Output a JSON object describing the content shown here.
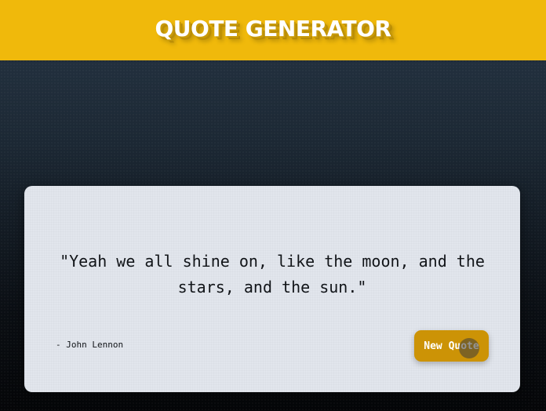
{
  "header": {
    "title": "QUOTE GENERATOR"
  },
  "quote": {
    "text": "\"Yeah we all shine on, like the moon, and the stars, and the sun.\"",
    "author": "- John Lennon"
  },
  "actions": {
    "new_quote_label": "New Quote"
  },
  "colors": {
    "header_bg": "#f0b90b",
    "button_bg": "#cc9306",
    "card_bg": "#e2e6ed",
    "page_bg_top": "#263544",
    "page_bg_bottom": "#050608"
  }
}
